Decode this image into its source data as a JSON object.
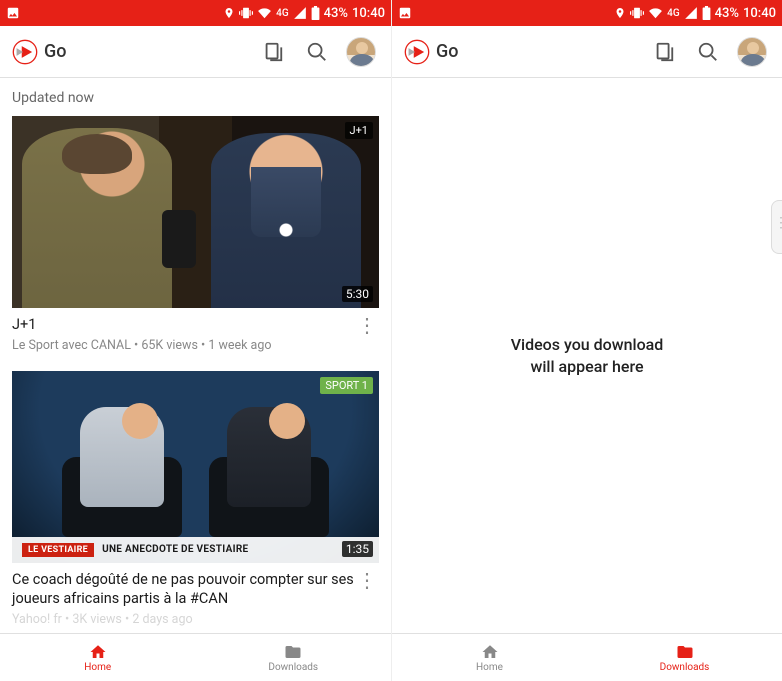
{
  "status": {
    "network_label": "4G",
    "battery": "43%",
    "time": "10:40"
  },
  "app": {
    "name": "Go"
  },
  "feed": {
    "updated_label": "Updated now",
    "videos": [
      {
        "badge": "J+1",
        "duration": "5:30",
        "title": "J+1",
        "channel": "Le Sport avec CANAL",
        "views": "65K views",
        "age": "1 week ago"
      },
      {
        "badge": "SPORT 1",
        "duration": "1:35",
        "chyron_tag": "LE VESTIAIRE",
        "chyron": "UNE ANECDOTE DE VESTIAIRE",
        "title": "Ce coach dégoûté de ne pas pouvoir compter sur ses joueurs africains partis à la #CAN",
        "channel": "Yahoo! fr",
        "views": "3K views",
        "age": "2 days ago"
      }
    ]
  },
  "downloads": {
    "empty_line1": "Videos you download",
    "empty_line2": "will appear here"
  },
  "nav": {
    "home": "Home",
    "downloads": "Downloads"
  }
}
